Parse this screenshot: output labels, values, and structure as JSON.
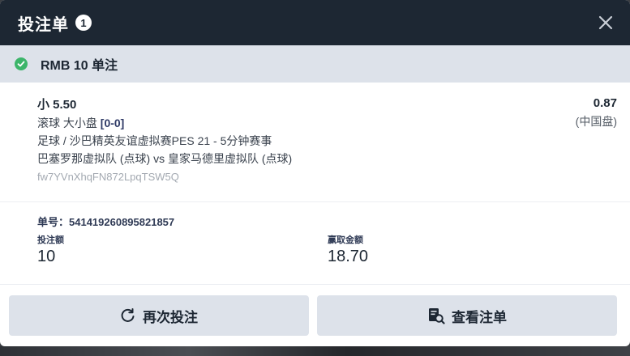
{
  "header": {
    "title": "投注单",
    "count": "1"
  },
  "status": {
    "text": "RMB 10 单注",
    "color": "#3cb56a"
  },
  "bet": {
    "selection": "小 5.50",
    "odds": "0.87",
    "odds_type": "(中国盘)",
    "market_prefix": "滚球 大小盘 ",
    "score": "[0-0]",
    "league": "足球 / 沙巴精英友谊虚拟赛PES 21 - 5分钟赛事",
    "match": "巴塞罗那虚拟队 (点球) vs 皇家马德里虚拟队 (点球)",
    "code": "fw7YVnXhqFN872LpqTSW5Q"
  },
  "info": {
    "order_label": "单号：541419260895821857",
    "stake_label": "投注额",
    "stake_value": "10",
    "win_label": "赢取金额",
    "win_value": "18.70"
  },
  "actions": {
    "rebet_label": "再次投注",
    "rebet_icon": "refresh-icon",
    "view_label": "查看注单",
    "view_icon": "receipt-search-icon"
  }
}
